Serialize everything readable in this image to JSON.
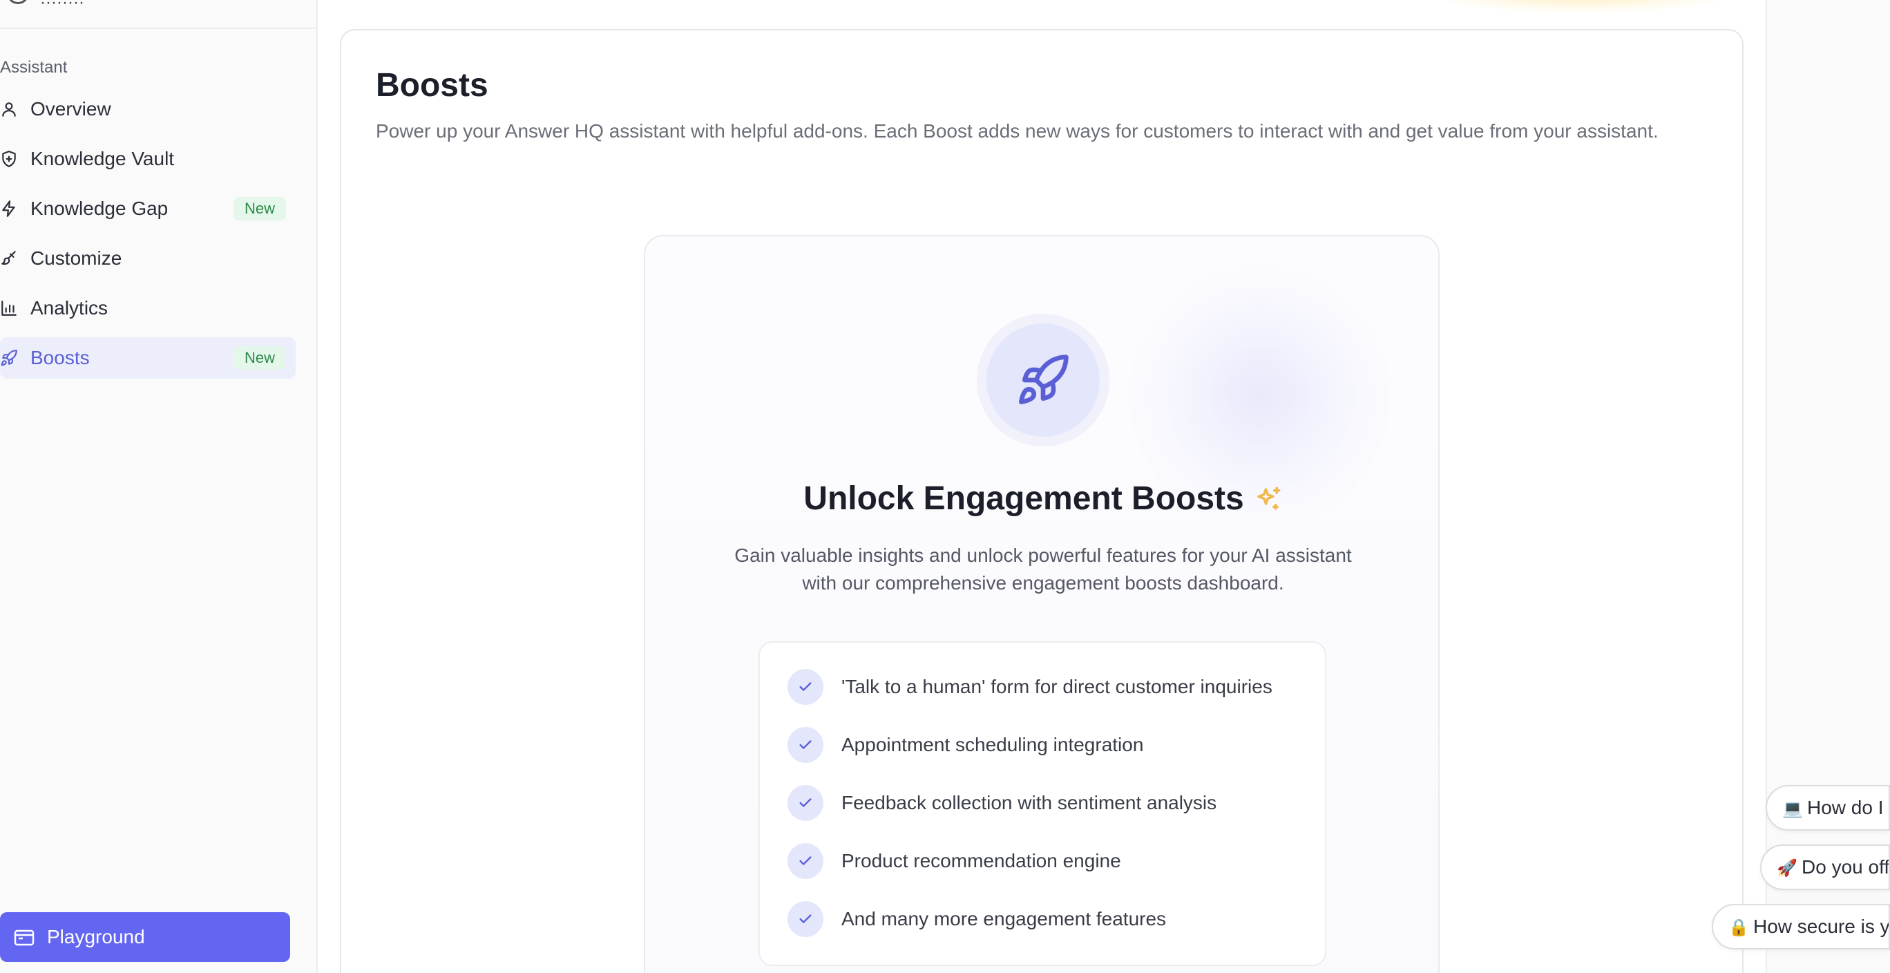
{
  "sidebar": {
    "top_text": "········",
    "section_label": "Assistant",
    "items": [
      {
        "label": "Overview",
        "icon": "user-icon",
        "badge": ""
      },
      {
        "label": "Knowledge Vault",
        "icon": "shield-icon",
        "badge": ""
      },
      {
        "label": "Knowledge Gap",
        "icon": "lightning-icon",
        "badge": "New"
      },
      {
        "label": "Customize",
        "icon": "paintbrush-icon",
        "badge": ""
      },
      {
        "label": "Analytics",
        "icon": "bar-chart-icon",
        "badge": ""
      },
      {
        "label": "Boosts",
        "icon": "rocket-icon",
        "badge": "New",
        "active": true
      }
    ],
    "playground_label": "Playground"
  },
  "main": {
    "title": "Boosts",
    "description": "Power up your Answer HQ assistant with helpful add-ons. Each Boost adds new ways for customers to interact with and get value from your assistant."
  },
  "promo": {
    "title": "Unlock Engagement Boosts",
    "description": "Gain valuable insights and unlock powerful features for your AI assistant with our comprehensive engagement boosts dashboard.",
    "features": [
      "'Talk to a human' form for direct customer inquiries",
      "Appointment scheduling integration",
      "Feedback collection with sentiment analysis",
      "Product recommendation engine",
      "And many more engagement features"
    ]
  },
  "chips": [
    {
      "emoji": "💻",
      "text": "How do I"
    },
    {
      "emoji": "🚀",
      "text": "Do you off"
    },
    {
      "emoji": "🔒",
      "text": "How secure is y"
    }
  ],
  "colors": {
    "accent": "#6366f1",
    "active_bg": "#eceefb",
    "badge_bg": "#e4f7ea",
    "badge_text": "#2e8a4c",
    "sparkle": "#f2b84b"
  }
}
